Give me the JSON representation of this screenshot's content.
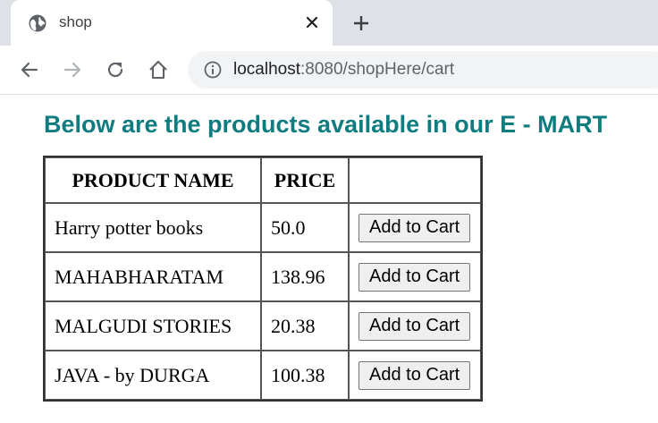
{
  "browser": {
    "tab_title": "shop",
    "url_host": "localhost",
    "url_rest": ":8080/shopHere/cart"
  },
  "page": {
    "heading": "Below are the products available in our E - MART",
    "heading_color": "#0f7c80",
    "table": {
      "headers": [
        "PRODUCT NAME",
        "PRICE",
        ""
      ],
      "rows": [
        {
          "name": "Harry potter books",
          "price": "50.0",
          "action": "Add to Cart"
        },
        {
          "name": "MAHABHARATAM",
          "price": "138.96",
          "action": "Add to Cart"
        },
        {
          "name": "MALGUDI STORIES",
          "price": "20.38",
          "action": "Add to Cart"
        },
        {
          "name": "JAVA - by DURGA",
          "price": "100.38",
          "action": "Add to Cart"
        }
      ]
    }
  },
  "icons": [
    "globe-icon",
    "close-icon",
    "new-tab-icon",
    "back-icon",
    "forward-icon",
    "reload-icon",
    "home-icon",
    "info-icon"
  ]
}
